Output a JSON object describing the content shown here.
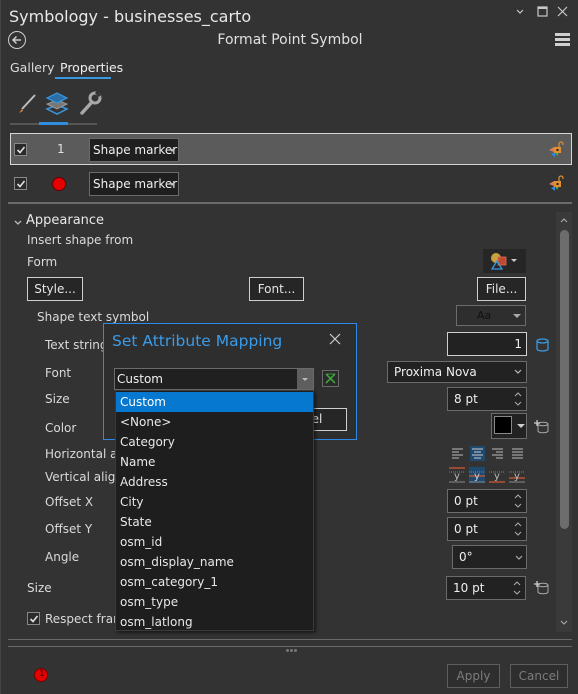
{
  "window": {
    "title": "Symbology - businesses_carto",
    "controls": [
      "chevron-down",
      "maximize",
      "close"
    ]
  },
  "header": {
    "subtitle": "Format Point Symbol"
  },
  "tabs": [
    {
      "label": "Gallery",
      "active": false
    },
    {
      "label": "Properties",
      "active": true
    }
  ],
  "tool_tabs": [
    {
      "name": "symbol",
      "icon": "paintbrush-icon",
      "active": false
    },
    {
      "name": "layers",
      "icon": "layers-icon",
      "active": true
    },
    {
      "name": "structure",
      "icon": "wrench-icon",
      "active": false
    }
  ],
  "layers": [
    {
      "checked": true,
      "index": "1",
      "type": "Shape marker",
      "selected": true
    },
    {
      "checked": true,
      "index": "",
      "type": "Shape marker",
      "selected": false,
      "swatch_color": "#e50000"
    }
  ],
  "appearance": {
    "section_label": "Appearance",
    "insert_shape_from": "Insert shape from",
    "form": "Form",
    "style_button": "Style...",
    "font_button": "Font...",
    "file_button": "File...",
    "shape_text_symbol": "Shape text symbol",
    "shape_text_preview": "Aa",
    "text_string_label": "Text string",
    "text_string_value": "1",
    "font_label": "Font",
    "font_value": "Proxima Nova",
    "size_label": "Size",
    "size_value": "8 pt",
    "color_label": "Color",
    "color_value": "#000000",
    "horizontal_alignment_label": "Horizontal ali",
    "vertical_alignment_label": "Vertical alignı",
    "horizontal_alignment_selected": "center",
    "vertical_alignment_selected": "center",
    "offset_x_label": "Offset X",
    "offset_x_value": "0 pt",
    "offset_y_label": "Offset Y",
    "offset_y_value": "0 pt",
    "angle_label": "Angle",
    "angle_value": "0°",
    "outer_size_label": "Size",
    "outer_size_value": "10 pt",
    "respect_frame_label": "Respect fram",
    "respect_frame_checked": true
  },
  "dialog": {
    "title": "Set Attribute Mapping",
    "combo_value": "Custom",
    "cancel_partial": "cel",
    "options": [
      "Custom",
      "<None>",
      "Category",
      "Name",
      "Address",
      "City",
      "State",
      "osm_id",
      "osm_display_name",
      "osm_category_1",
      "osm_type",
      "osm_latlong"
    ],
    "selected_option": "Custom"
  },
  "footer": {
    "apply": "Apply",
    "cancel": "Cancel",
    "error_count": "1"
  },
  "colors": {
    "accent": "#3a98e0",
    "list_selection": "#0678cf",
    "marker_red": "#e50000",
    "background": "#333333"
  }
}
